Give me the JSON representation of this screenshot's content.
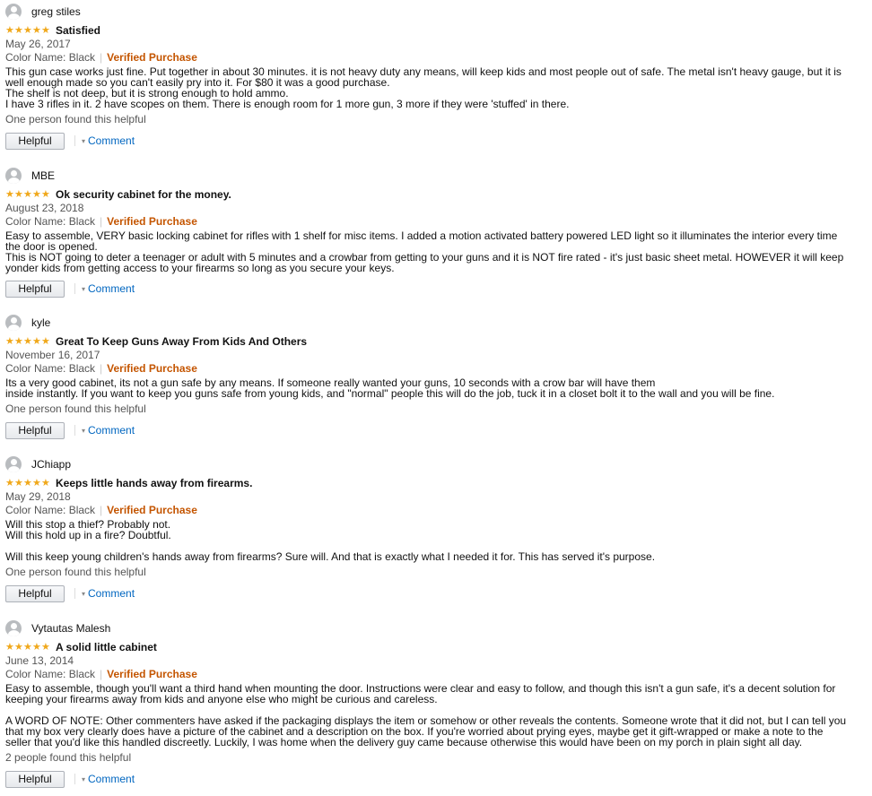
{
  "reviews": [
    {
      "author": "greg stiles",
      "rating": 5,
      "title": "Satisfied",
      "date": "May 26, 2017",
      "color_name": "Color Name: Black",
      "verified": "Verified Purchase",
      "body": "This gun case works just fine. Put together in about 30 minutes. it is not heavy duty any means, will keep kids and most people out of safe. The metal isn't heavy gauge, but it is\nwell enough made so you can't easily pry into it. For $80 it was a good purchase.\nThe shelf is not deep, but it is strong enough to hold ammo.\nI have 3 rifles in it. 2 have scopes on them. There is enough room for 1 more gun, 3 more if they were 'stuffed' in there.",
      "helpful_count": "One person found this helpful",
      "helpful_label": "Helpful",
      "comment_label": "Comment"
    },
    {
      "author": "MBE",
      "rating": 5,
      "title": "Ok security cabinet for the money.",
      "date": "August 23, 2018",
      "color_name": "Color Name: Black",
      "verified": "Verified Purchase",
      "body": "Easy to assemble, VERY basic locking cabinet for rifles with 1 shelf for misc items. I added a motion activated battery powered LED light so it illuminates the interior every time\nthe door is opened.\nThis is NOT going to deter a teenager or adult with 5 minutes and a crowbar from getting to your guns and it is NOT fire rated - it's just basic sheet metal. HOWEVER it will keep\nyonder kids from getting access to your firearms so long as you secure your keys.",
      "helpful_count": "",
      "helpful_label": "Helpful",
      "comment_label": "Comment"
    },
    {
      "author": "kyle",
      "rating": 5,
      "title": "Great To Keep Guns Away From Kids And Others",
      "date": "November 16, 2017",
      "color_name": "Color Name: Black",
      "verified": "Verified Purchase",
      "body": "Its a very good cabinet, its not a gun safe by any means. If someone really wanted your guns, 10 seconds with a crow bar will have them\ninside instantly. If you want to keep you guns safe from young kids, and \"normal\" people this will do the job, tuck it in a closet bolt it to the wall and you will be fine.",
      "helpful_count": "One person found this helpful",
      "helpful_label": "Helpful",
      "comment_label": "Comment"
    },
    {
      "author": "JChiapp",
      "rating": 5,
      "title": "Keeps little hands away from firearms.",
      "date": "May 29, 2018",
      "color_name": "Color Name: Black",
      "verified": "Verified Purchase",
      "body": "Will this stop a thief? Probably not.\nWill this hold up in a fire? Doubtful.\n\nWill this keep young children's hands away from firearms? Sure will. And that is exactly what I needed it for. This has served it's purpose.",
      "helpful_count": "One person found this helpful",
      "helpful_label": "Helpful",
      "comment_label": "Comment"
    },
    {
      "author": "Vytautas Malesh",
      "rating": 5,
      "title": "A solid little cabinet",
      "date": "June 13, 2014",
      "color_name": "Color Name: Black",
      "verified": "Verified Purchase",
      "body": "Easy to assemble, though you'll want a third hand when mounting the door. Instructions were clear and easy to follow, and though this isn't a gun safe, it's a decent solution for\nkeeping your firearms away from kids and anyone else who might be curious and careless.\n\nA WORD OF NOTE: Other commenters have asked if the packaging displays the item or somehow or other reveals the contents. Someone wrote that it did not, but I can tell you\nthat my box very clearly does have a picture of the cabinet and a description on the box. If you're worried about prying eyes, maybe get it gift-wrapped or make a note to the\nseller that you'd like this handled discreetly. Luckily, I was home when the delivery guy came because otherwise this would have been on my porch in plain sight all day.",
      "helpful_count": "2 people found this helpful",
      "helpful_label": "Helpful",
      "comment_label": "Comment"
    }
  ]
}
